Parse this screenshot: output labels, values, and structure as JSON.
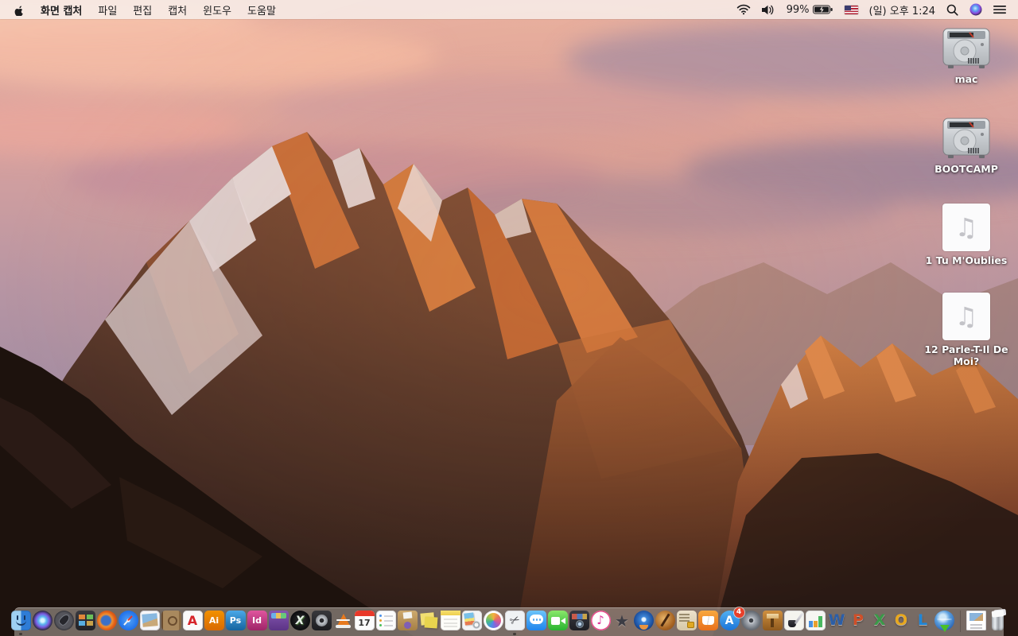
{
  "menu_bar": {
    "app_name": "화면 캡처",
    "menus": [
      "파일",
      "편집",
      "캡처",
      "윈도우",
      "도움말"
    ],
    "status": {
      "battery_percent": "99%",
      "clock": "(일) 오후 1:24"
    }
  },
  "desktop": {
    "icons": [
      {
        "id": "mac",
        "label": "mac",
        "type": "hard-drive"
      },
      {
        "id": "bootcamp",
        "label": "BOOTCAMP",
        "type": "hard-drive"
      },
      {
        "id": "song1",
        "label": "1 Tu M'Oublies",
        "type": "audio-file"
      },
      {
        "id": "song2",
        "label": "12 Parle-T-Il De Moi?",
        "type": "audio-file"
      }
    ]
  },
  "dock": {
    "items": [
      {
        "id": "finder",
        "name": "Finder",
        "running": true
      },
      {
        "id": "siri",
        "name": "Siri"
      },
      {
        "id": "launchpad",
        "name": "Launchpad"
      },
      {
        "id": "mission-control",
        "name": "Mission Control"
      },
      {
        "id": "firefox",
        "name": "Firefox"
      },
      {
        "id": "safari",
        "name": "Safari"
      },
      {
        "id": "preview",
        "name": "Preview"
      },
      {
        "id": "contacts",
        "name": "Contacts"
      },
      {
        "id": "acrobat",
        "name": "Adobe Acrobat Reader",
        "glyph": "A"
      },
      {
        "id": "illustrator",
        "name": "Adobe Illustrator",
        "glyph": "Ai"
      },
      {
        "id": "photoshop",
        "name": "Adobe Photoshop",
        "glyph": "Ps"
      },
      {
        "id": "indesign",
        "name": "Adobe InDesign",
        "glyph": "Id"
      },
      {
        "id": "toolbox",
        "name": "utility toolbox app"
      },
      {
        "id": "x11",
        "name": "X11",
        "glyph": "X"
      },
      {
        "id": "diskutil",
        "name": "disk utility app"
      },
      {
        "id": "vlc",
        "name": "VLC media player"
      },
      {
        "id": "calendar",
        "name": "Calendar",
        "glyph": "17"
      },
      {
        "id": "reminders",
        "name": "Reminders"
      },
      {
        "id": "unarchiver",
        "name": "archive utility app"
      },
      {
        "id": "stickies",
        "name": "Stickies"
      },
      {
        "id": "notes",
        "name": "Notes"
      },
      {
        "id": "photocards",
        "name": "photo cards app"
      },
      {
        "id": "photos",
        "name": "Photos"
      },
      {
        "id": "grab",
        "name": "Grab screen capture",
        "glyph": "✂",
        "running": true
      },
      {
        "id": "messages",
        "name": "Messages"
      },
      {
        "id": "facetime",
        "name": "FaceTime"
      },
      {
        "id": "photobooth",
        "name": "Photo Booth"
      },
      {
        "id": "itunes",
        "name": "iTunes",
        "glyph": "♪"
      },
      {
        "id": "imovie",
        "name": "star badge app",
        "glyph": "★"
      },
      {
        "id": "dvd",
        "name": "DVD disc app"
      },
      {
        "id": "garageband",
        "name": "GarageBand"
      },
      {
        "id": "securedocs",
        "name": "documents with lock app"
      },
      {
        "id": "ibooks",
        "name": "iBooks"
      },
      {
        "id": "appstore",
        "name": "App Store",
        "glyph": "A",
        "badge": "4"
      },
      {
        "id": "sysprefs",
        "name": "System Preferences"
      },
      {
        "id": "keynote",
        "name": "Keynote 09"
      },
      {
        "id": "pages",
        "name": "Pages 09"
      },
      {
        "id": "numbers",
        "name": "Numbers 09"
      },
      {
        "id": "word",
        "name": "Microsoft Word",
        "glyph": "W"
      },
      {
        "id": "powerpoint",
        "name": "Microsoft PowerPoint",
        "glyph": "P"
      },
      {
        "id": "excel",
        "name": "Microsoft Excel",
        "glyph": "X"
      },
      {
        "id": "outlook",
        "name": "Microsoft Outlook",
        "glyph": "O"
      },
      {
        "id": "lync",
        "name": "Microsoft Lync",
        "glyph": "L"
      },
      {
        "id": "downloader",
        "name": "globe download app"
      },
      {
        "type": "separator"
      },
      {
        "id": "docfile",
        "name": "document file"
      },
      {
        "id": "trash",
        "name": "Trash full"
      }
    ]
  },
  "colors": {
    "badge_red": "#e8402a",
    "menubar_tint": "#f8f0ed",
    "dock_tint": "#b8aea8"
  }
}
